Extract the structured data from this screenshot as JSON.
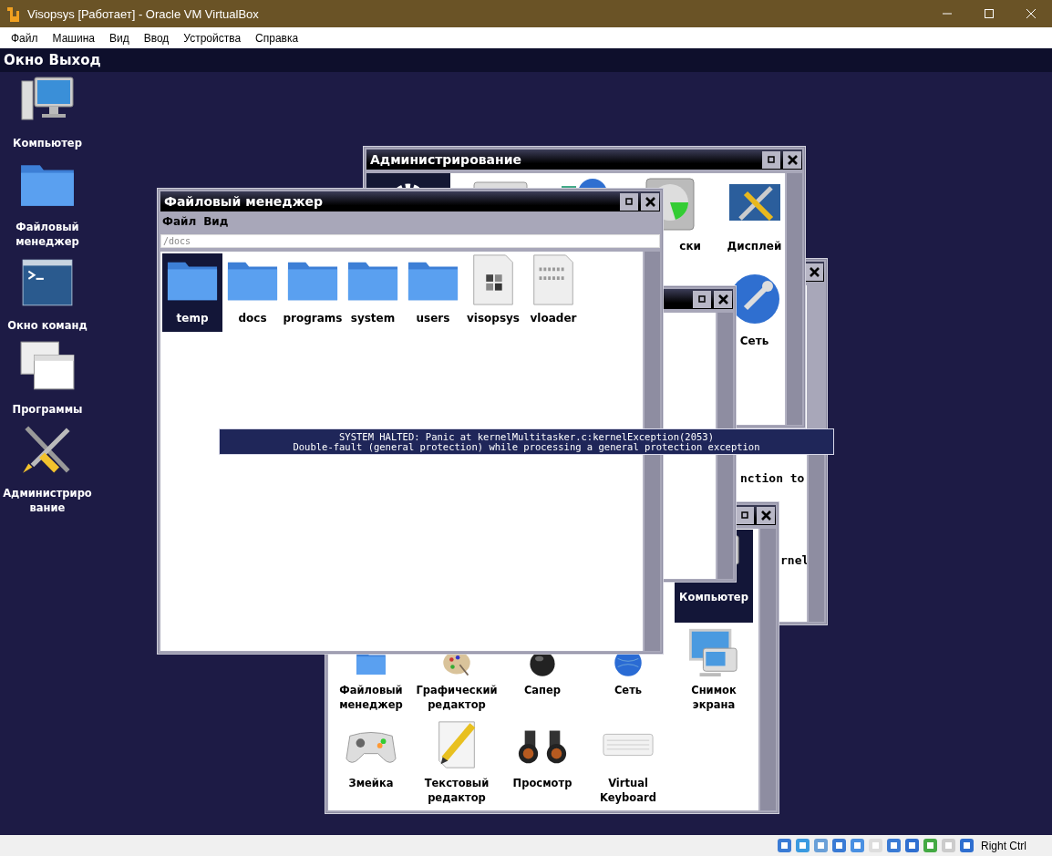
{
  "host": {
    "title": "Visopsys [Работает] - Oracle VM VirtualBox",
    "menu": [
      "Файл",
      "Машина",
      "Вид",
      "Ввод",
      "Устройства",
      "Справка"
    ],
    "host_key": "Right Ctrl"
  },
  "guest": {
    "top_menu": [
      "Окно",
      "Выход"
    ],
    "desktop_icons": [
      {
        "label": "Компьютер"
      },
      {
        "label": "Файловый менеджер"
      },
      {
        "label": "Окно команд"
      },
      {
        "label": "Программы"
      },
      {
        "label": "Администрирование"
      }
    ]
  },
  "admin_window": {
    "title": "Администрирование",
    "items": [
      {
        "label": "ски"
      },
      {
        "label": "Дисплей"
      },
      {
        "label": "Сеть"
      }
    ]
  },
  "text_window": {
    "lines": [
      "nction to",
      "rnel"
    ]
  },
  "programs_window": {
    "items": [
      {
        "label": "Компьютер",
        "selected": true
      },
      {
        "label": "Файловый менеджер",
        "selected": false
      },
      {
        "label": "Графический редактор",
        "selected": false
      },
      {
        "label": "Сапер",
        "selected": false
      },
      {
        "label": "Сеть",
        "selected": false
      },
      {
        "label": "Снимок экрана",
        "selected": false
      },
      {
        "label": "Змейка",
        "selected": false
      },
      {
        "label": "Текстовый редактор",
        "selected": false
      },
      {
        "label": "Просмотр",
        "selected": false
      },
      {
        "label": "Virtual Keyboard",
        "selected": false
      }
    ]
  },
  "file_manager": {
    "title": "Файловый менеджер",
    "menu": [
      "Файл",
      "Вид"
    ],
    "path": "/docs",
    "items": [
      {
        "name": "temp",
        "kind": "folder",
        "selected": true
      },
      {
        "name": "docs",
        "kind": "folder",
        "selected": false
      },
      {
        "name": "programs",
        "kind": "folder",
        "selected": false
      },
      {
        "name": "system",
        "kind": "folder",
        "selected": false
      },
      {
        "name": "users",
        "kind": "folder",
        "selected": false
      },
      {
        "name": "visopsys",
        "kind": "program",
        "selected": false
      },
      {
        "name": "vloader",
        "kind": "binary",
        "selected": false
      }
    ]
  },
  "panic": {
    "lines": [
      "SYSTEM HALTED: Panic at kernelMultitasker.c:kernelException(2053)",
      "Double-fault (general protection) while processing a general protection exception"
    ]
  }
}
